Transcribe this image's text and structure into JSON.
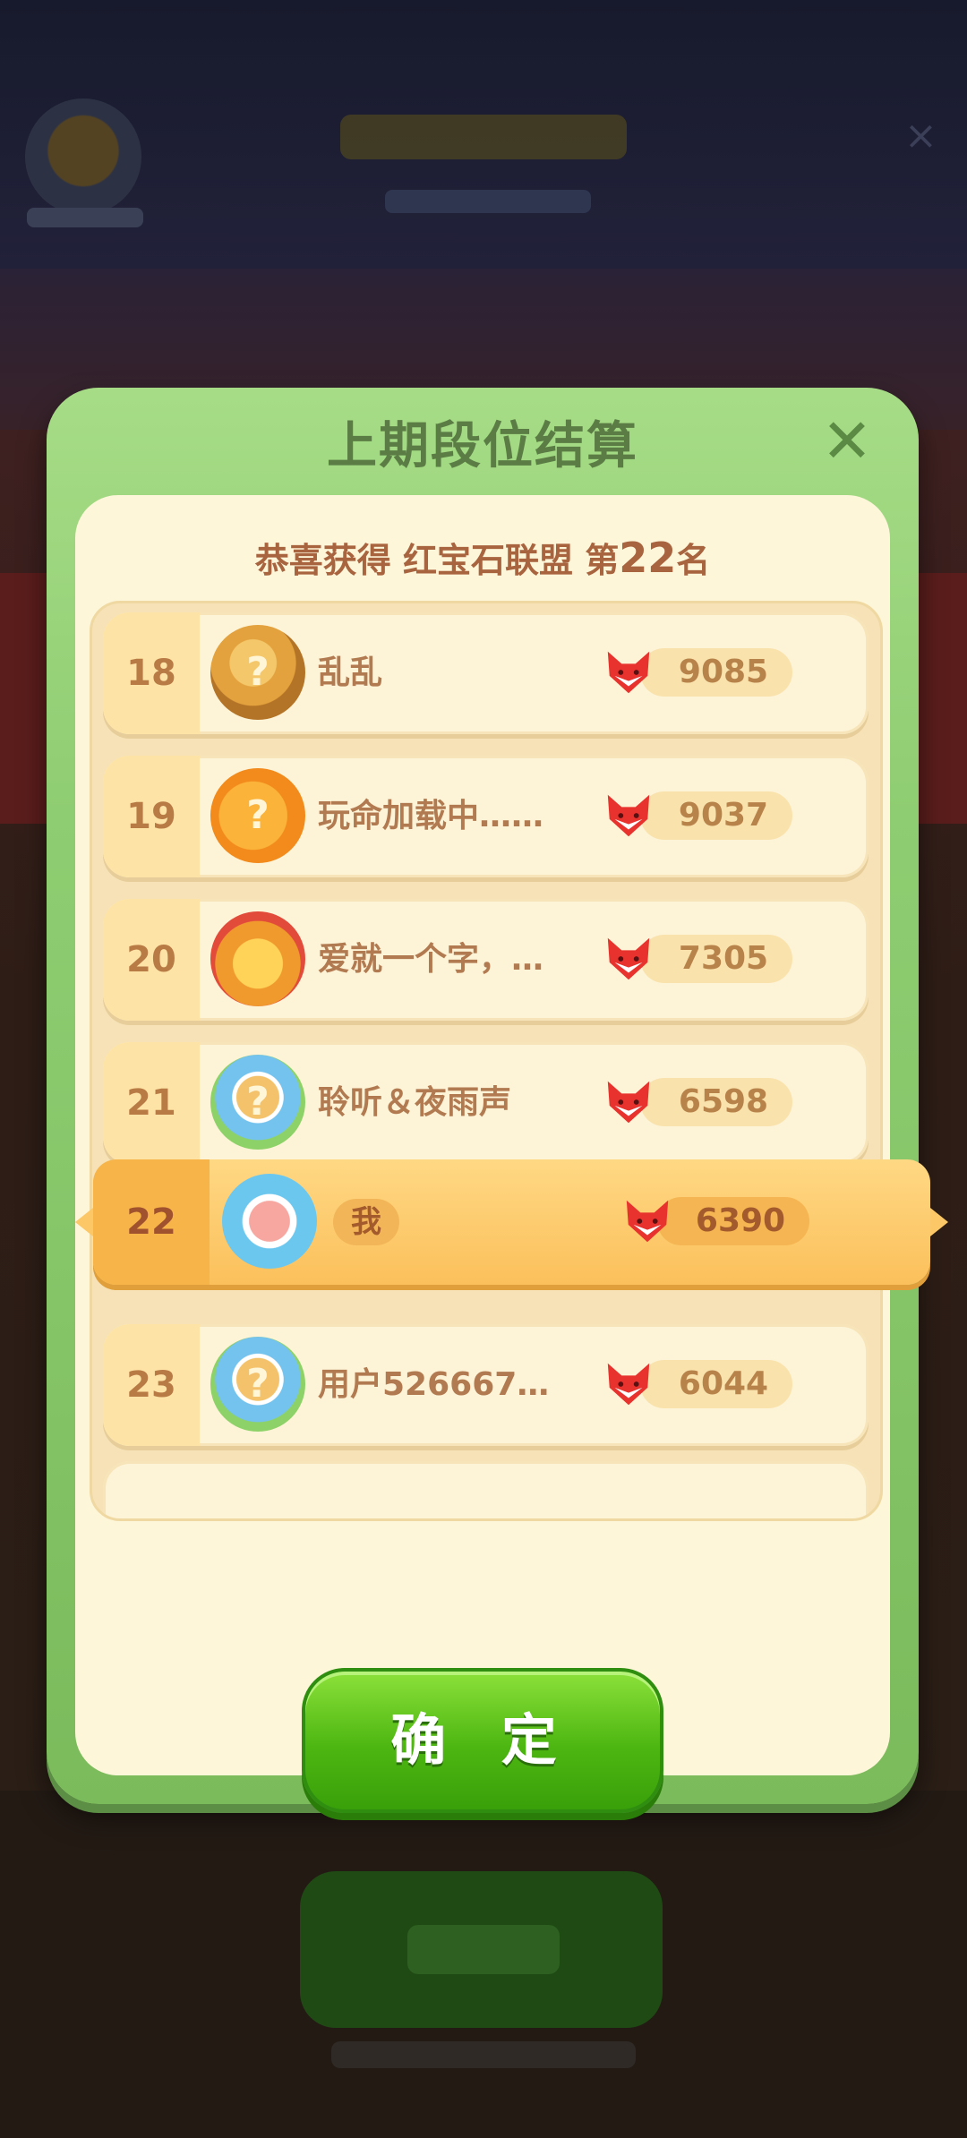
{
  "dialog": {
    "title": "上期段位结算",
    "subtitle_prefix": "恭喜获得 红宝石联盟 第",
    "subtitle_rank": "22",
    "subtitle_suffix": "名",
    "confirm_label": "确 定"
  },
  "leaderboard": [
    {
      "rank": "18",
      "name": "乱乱",
      "score": "9085",
      "avatar_badge": "?"
    },
    {
      "rank": "19",
      "name": "玩命加载中……",
      "score": "9037",
      "avatar_badge": "?"
    },
    {
      "rank": "20",
      "name": "爱就一个字，…",
      "score": "7305",
      "avatar_badge": ""
    },
    {
      "rank": "21",
      "name": "聆听＆夜雨声",
      "score": "6598",
      "avatar_badge": "?"
    },
    {
      "rank": "23",
      "name": "用户526667…",
      "score": "6044",
      "avatar_badge": "?"
    }
  ],
  "me": {
    "rank": "22",
    "name": "我",
    "score": "6390"
  },
  "icons": {
    "close": "close-icon",
    "score": "fox-token-icon"
  },
  "colors": {
    "dialog_green": "#8fcd72",
    "highlight_orange": "#fbc05b",
    "confirm_green": "#4db611"
  }
}
